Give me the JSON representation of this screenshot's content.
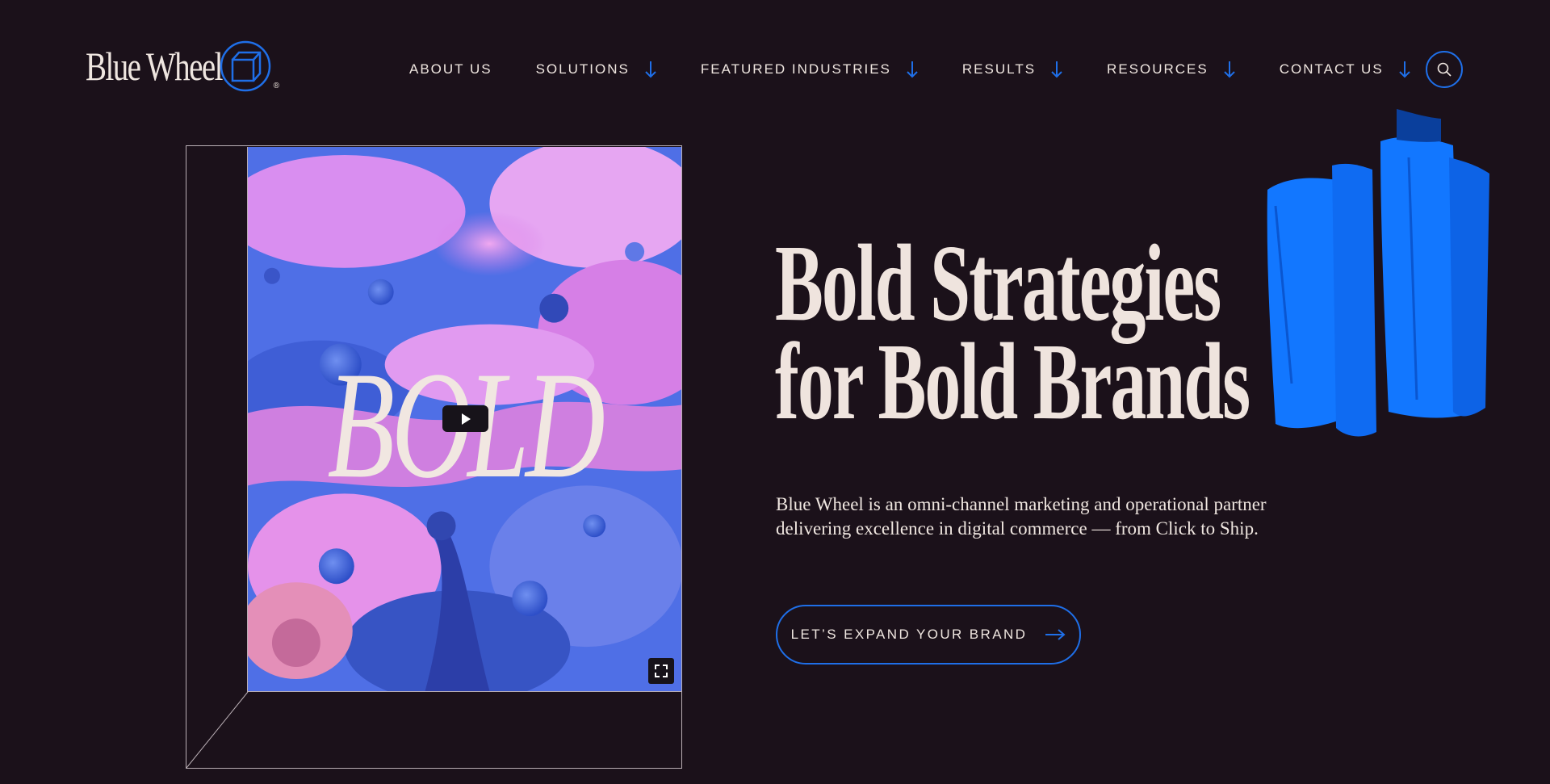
{
  "brand": {
    "name": "Blue Wheel",
    "registered": "®",
    "accent": "#1f6fe8",
    "background": "#1b111a"
  },
  "nav": {
    "items": [
      {
        "label": "ABOUT US",
        "dropdown": false
      },
      {
        "label": "SOLUTIONS",
        "dropdown": true
      },
      {
        "label": "FEATURED INDUSTRIES",
        "dropdown": true
      },
      {
        "label": "RESULTS",
        "dropdown": true
      },
      {
        "label": "RESOURCES",
        "dropdown": true
      },
      {
        "label": "CONTACT US",
        "dropdown": true
      }
    ],
    "search_icon": "search-icon"
  },
  "video": {
    "overlay_word": "BOLD",
    "play_icon": "play-icon",
    "fullscreen_icon": "fullscreen-icon"
  },
  "hero": {
    "title_line1": "Bold Strategies",
    "title_line2": "for Bold Brands",
    "description": "Blue Wheel is an omni-channel marketing and operational partner delivering excellence in digital commerce — from Click to Ship.",
    "cta_label": "LET’S EXPAND YOUR BRAND",
    "cta_icon": "arrow-right-icon"
  }
}
